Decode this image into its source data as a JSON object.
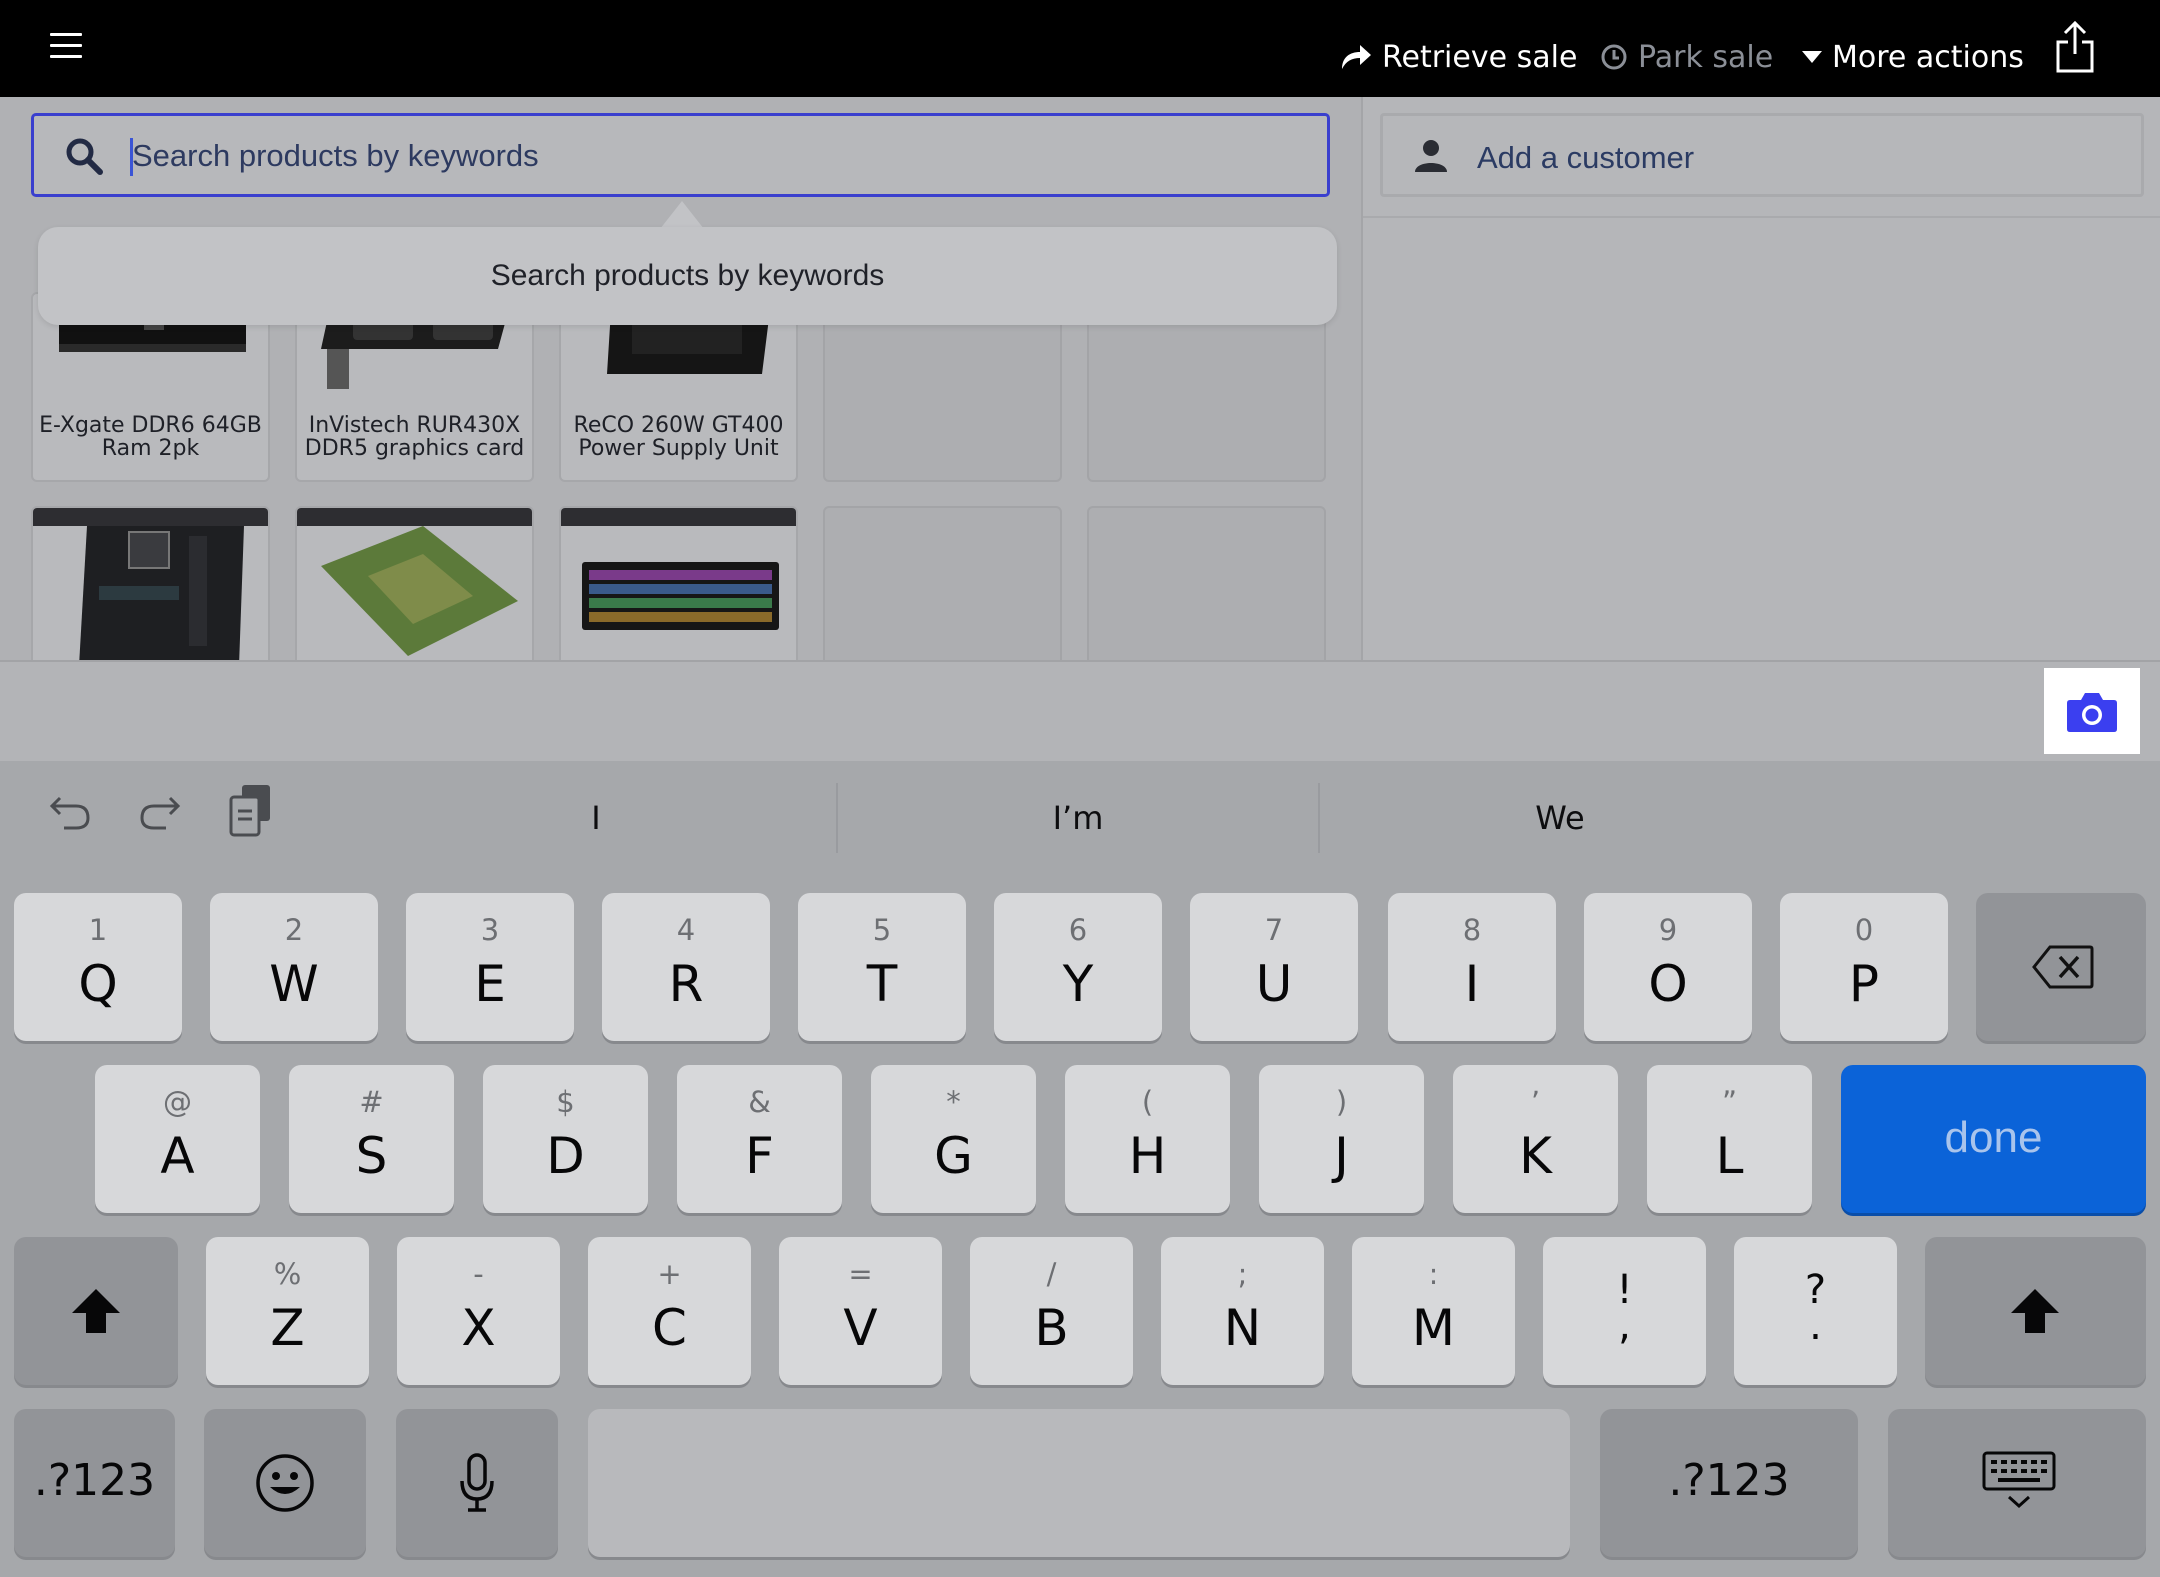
{
  "topbar": {
    "retrieve_label": "Retrieve sale",
    "park_label": "Park sale",
    "more_label": "More actions"
  },
  "search": {
    "value": "",
    "placeholder": "Search products by keywords",
    "tooltip": "Search products by keywords"
  },
  "products": [
    {
      "name": "E-Xgate DDR6 64GB Ram 2pk"
    },
    {
      "name": "InVistech RUR430X DDR5 graphics card"
    },
    {
      "name": "ReCO 260W GT400 Power Supply Unit"
    }
  ],
  "customer": {
    "label": "Add a customer"
  },
  "keyboard": {
    "suggestions": [
      "I",
      "I’m",
      "We"
    ],
    "row1": [
      {
        "sec": "1",
        "pri": "Q"
      },
      {
        "sec": "2",
        "pri": "W"
      },
      {
        "sec": "3",
        "pri": "E"
      },
      {
        "sec": "4",
        "pri": "R"
      },
      {
        "sec": "5",
        "pri": "T"
      },
      {
        "sec": "6",
        "pri": "Y"
      },
      {
        "sec": "7",
        "pri": "U"
      },
      {
        "sec": "8",
        "pri": "I"
      },
      {
        "sec": "9",
        "pri": "O"
      },
      {
        "sec": "0",
        "pri": "P"
      }
    ],
    "row2": [
      {
        "sec": "@",
        "pri": "A"
      },
      {
        "sec": "#",
        "pri": "S"
      },
      {
        "sec": "$",
        "pri": "D"
      },
      {
        "sec": "&",
        "pri": "F"
      },
      {
        "sec": "*",
        "pri": "G"
      },
      {
        "sec": "(",
        "pri": "H"
      },
      {
        "sec": ")",
        "pri": "J"
      },
      {
        "sec": "’",
        "pri": "K"
      },
      {
        "sec": "”",
        "pri": "L"
      }
    ],
    "row3": [
      {
        "sec": "%",
        "pri": "Z"
      },
      {
        "sec": "-",
        "pri": "X"
      },
      {
        "sec": "+",
        "pri": "C"
      },
      {
        "sec": "=",
        "pri": "V"
      },
      {
        "sec": "/",
        "pri": "B"
      },
      {
        "sec": ";",
        "pri": "N"
      },
      {
        "sec": ":",
        "pri": "M"
      }
    ],
    "punct": [
      {
        "top": "!",
        "bottom": ","
      },
      {
        "top": "?",
        "bottom": "."
      }
    ],
    "done_label": "done",
    "numbers_label": ".?123"
  }
}
